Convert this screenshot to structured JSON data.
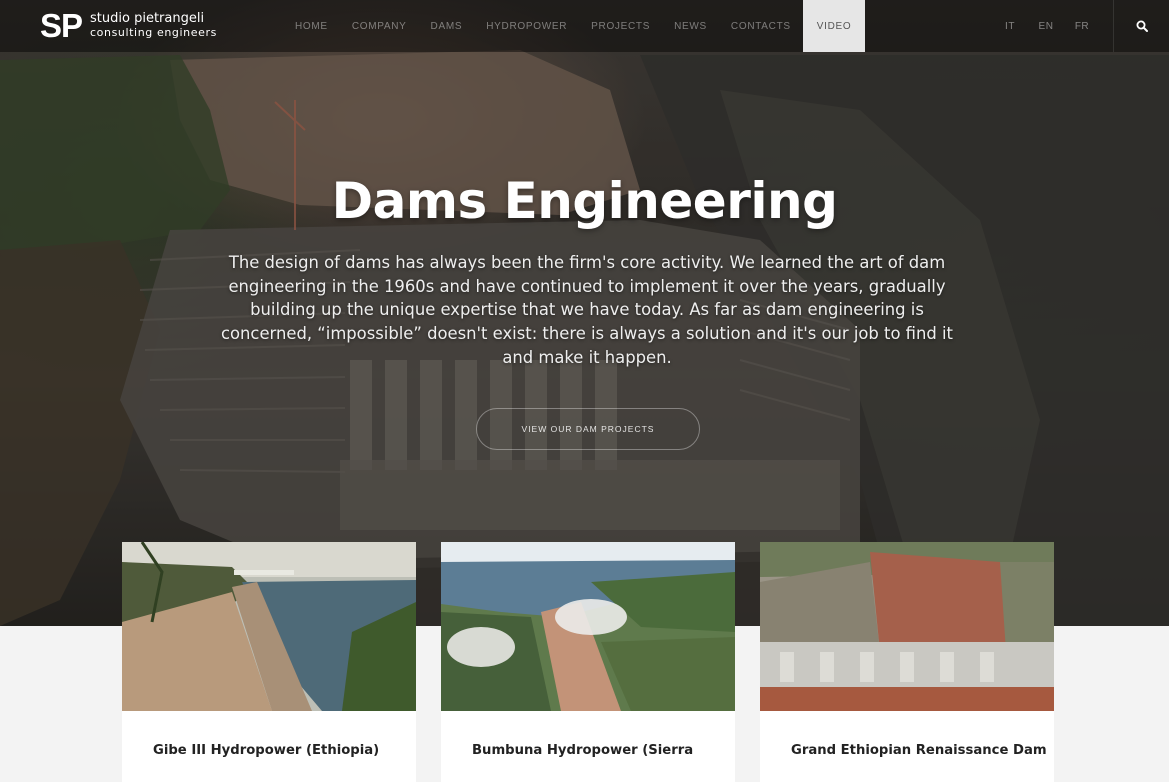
{
  "brand": {
    "mark": "SP",
    "name_line1": "studio pietrangeli",
    "name_line2": "consulting engineers"
  },
  "nav": {
    "items": [
      "HOME",
      "COMPANY",
      "DAMS",
      "HYDROPOWER",
      "PROJECTS",
      "NEWS",
      "CONTACTS",
      "VIDEO"
    ],
    "active": "VIDEO"
  },
  "languages": [
    "IT",
    "EN",
    "FR"
  ],
  "search": {
    "icon": "search-icon"
  },
  "hero": {
    "title": "Dams Engineering",
    "text": "The design of dams has always been the firm's core activity. We learned the art of dam engineering in the 1960s and have continued to implement it over the years, gradually building up the unique expertise that we have today. As far as dam engineering is concerned, “impossible” doesn't exist: there is always a solution and it's our job to find it and make it happen.",
    "cta_label": "VIEW OUR DAM PROJECTS"
  },
  "cards": [
    {
      "title": "Gibe III Hydropower (Ethiopia)"
    },
    {
      "title": "Bumbuna Hydropower (Sierra"
    },
    {
      "title": "Grand Ethiopian Renaissance Dam"
    }
  ],
  "colors": {
    "header_bg": "#000000",
    "nav_active_bg": "#e6e6e6",
    "page_bg": "#f3f3f3",
    "title_text": "#ffffff"
  }
}
